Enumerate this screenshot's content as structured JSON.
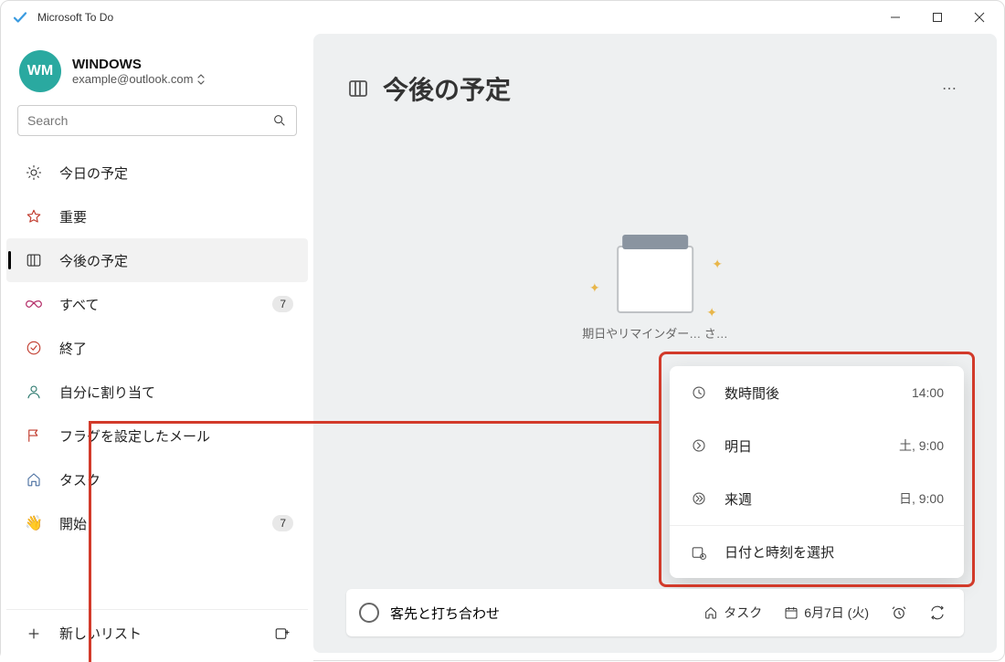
{
  "window": {
    "title": "Microsoft To Do"
  },
  "account": {
    "initials": "WM",
    "name": "WINDOWS",
    "email": "example@outlook.com"
  },
  "search": {
    "placeholder": "Search"
  },
  "nav": {
    "items": [
      {
        "label": "今日の予定"
      },
      {
        "label": "重要"
      },
      {
        "label": "今後の予定",
        "selected": true
      },
      {
        "label": "すべて",
        "badge": "7"
      },
      {
        "label": "終了"
      },
      {
        "label": "自分に割り当て"
      },
      {
        "label": "フラグを設定したメール"
      },
      {
        "label": "タスク"
      },
      {
        "label": "開始",
        "badge": "7"
      }
    ]
  },
  "sidebarFooter": {
    "newList": "新しいリスト"
  },
  "main": {
    "title": "今後の予定",
    "emptyCaption": "期日やリマインダー…\nさ…"
  },
  "addTask": {
    "text": "客先と打ち合わせ",
    "listLabel": "タスク",
    "dateLabel": "6月7日 (火)"
  },
  "popup": {
    "items": [
      {
        "label": "数時間後",
        "time": "14:00"
      },
      {
        "label": "明日",
        "time": "土, 9:00"
      },
      {
        "label": "来週",
        "time": "日, 9:00"
      }
    ],
    "pickLabel": "日付と時刻を選択"
  }
}
